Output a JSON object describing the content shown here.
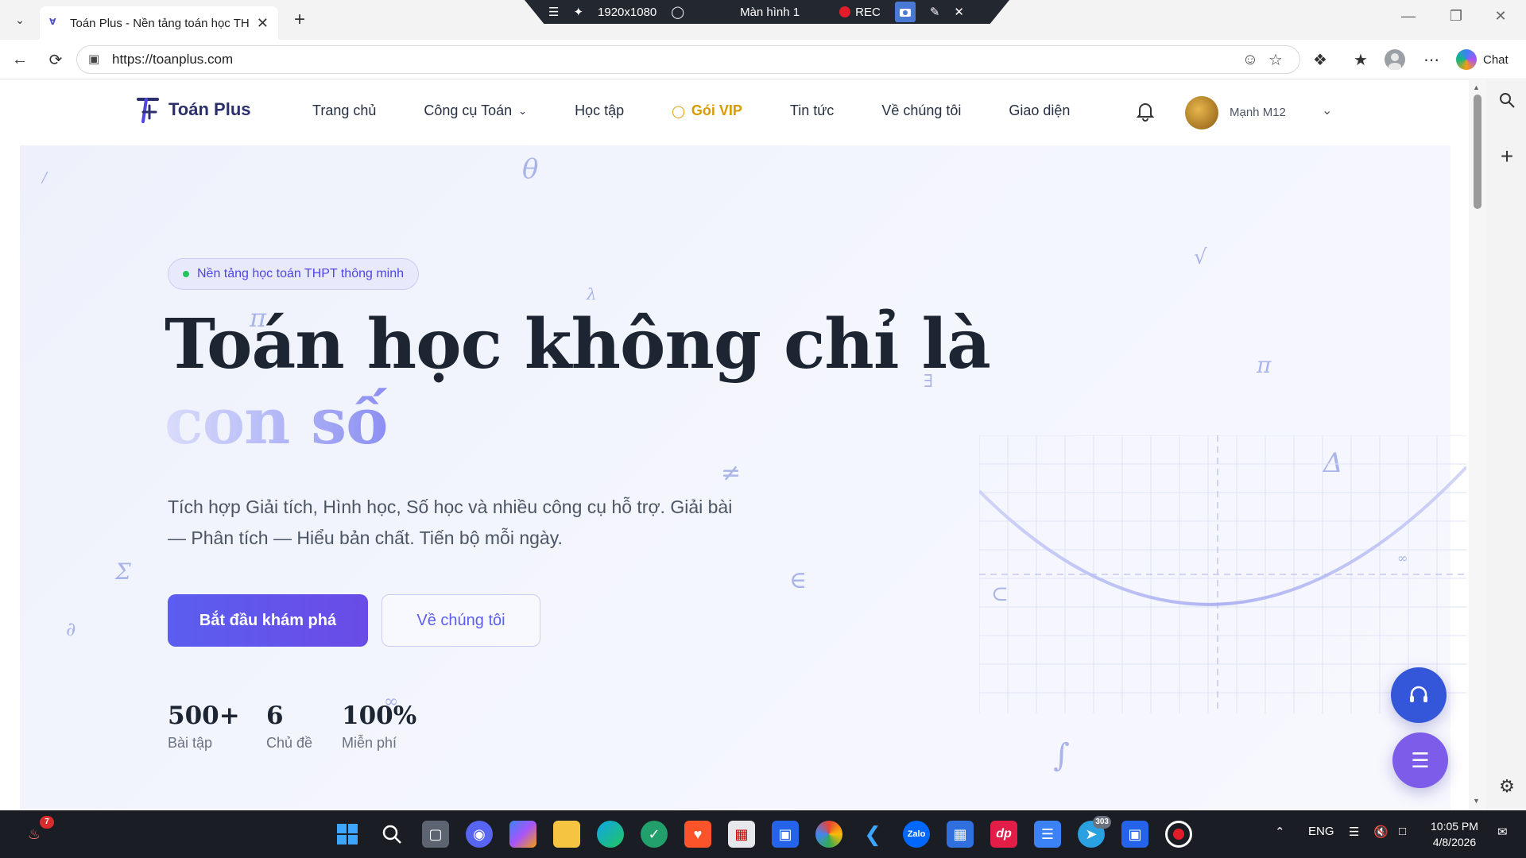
{
  "browser": {
    "tab_title": "Toán Plus - Nền tảng toán học THPT",
    "url": "https://toanplus.com",
    "chat_label": "Chat",
    "recorder": {
      "resolution": "1920x1080",
      "screen": "Màn hình 1",
      "rec": "REC"
    }
  },
  "site": {
    "logo_text": "Toán Plus",
    "menu": {
      "home": "Trang chủ",
      "tools": "Công cụ Toán",
      "learn": "Học tập",
      "vip": "Gói VIP",
      "news": "Tin tức",
      "about": "Về chúng tôi",
      "theme": "Giao diện"
    },
    "user_name": "Mạnh M12"
  },
  "hero": {
    "badge": "Nền tảng học toán THPT thông minh",
    "title_line1": "Toán học không chỉ là",
    "title_line2": "con số",
    "lead": "Tích hợp Giải tích, Hình học, Số học và nhiều công cụ hỗ trợ. Giải bài — Phân tích — Hiểu bản chất. Tiến bộ mỗi ngày.",
    "cta_primary": "Bắt đầu khám phá",
    "cta_secondary": "Về chúng tôi",
    "stats": [
      {
        "value": "500+",
        "label": "Bài tập"
      },
      {
        "value": "6",
        "label": "Chủ đề"
      },
      {
        "value": "100%",
        "label": "Miễn phí"
      }
    ]
  },
  "taskbar": {
    "notif_count": "7",
    "telegram_badge": "303",
    "lang": "ENG",
    "time": "10:05 PM",
    "date": "4/8/2026"
  },
  "colors": {
    "accent": "#5b5ef0",
    "vip": "#d99a00",
    "heading": "#1d2533"
  }
}
